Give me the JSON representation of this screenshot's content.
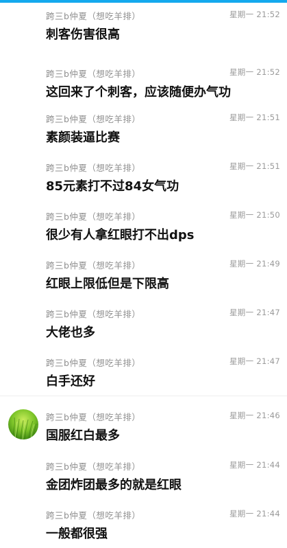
{
  "accent_color": "#14a9ee",
  "avatar_icon": "green-grass-avatar",
  "messages": [
    {
      "sender": "跨三b仲夏（想吃羊排）",
      "time": "星期一 21:52",
      "text": "刺客伤害很高"
    },
    {
      "sender": "跨三b仲夏（想吃羊排）",
      "time": "星期一 21:52",
      "text": "这回来了个刺客，应该随便办气功"
    },
    {
      "sender": "跨三b仲夏（想吃羊排）",
      "time": "星期一 21:51",
      "text": "素颜装逼比赛"
    },
    {
      "sender": "跨三b仲夏（想吃羊排）",
      "time": "星期一 21:51",
      "text": "85元素打不过84女气功"
    },
    {
      "sender": "跨三b仲夏（想吃羊排）",
      "time": "星期一 21:50",
      "text": "很少有人拿红眼打不出dps"
    },
    {
      "sender": "跨三b仲夏（想吃羊排）",
      "time": "星期一 21:49",
      "text": "红眼上限低但是下限高"
    },
    {
      "sender": "跨三b仲夏（想吃羊排）",
      "time": "星期一 21:47",
      "text": "大佬也多"
    },
    {
      "sender": "跨三b仲夏（想吃羊排）",
      "time": "星期一 21:47",
      "text": "白手还好"
    },
    {
      "sender": "跨三b仲夏（想吃羊排）",
      "time": "星期一 21:46",
      "text": "国服红白最多"
    },
    {
      "sender": "跨三b仲夏（想吃羊排）",
      "time": "星期一 21:44",
      "text": "金团炸团最多的就是红眼"
    },
    {
      "sender": "跨三b仲夏（想吃羊排）",
      "time": "星期一 21:44",
      "text": "一般都很强"
    }
  ]
}
